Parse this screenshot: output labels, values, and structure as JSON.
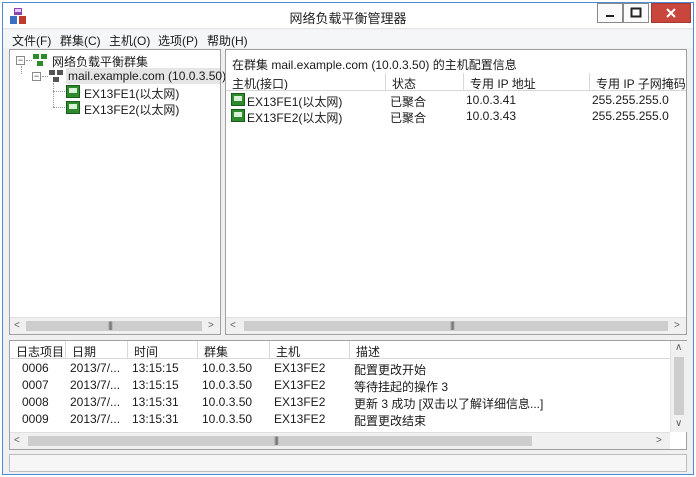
{
  "window": {
    "title": "网络负载平衡管理器"
  },
  "menu": [
    "文件(F)",
    "群集(C)",
    "主机(O)",
    "选项(P)",
    "帮助(H)"
  ],
  "tree": {
    "root": "网络负载平衡群集",
    "cluster": "mail.example.com (10.0.3.50)",
    "hosts": [
      "EX13FE1(以太网)",
      "EX13FE2(以太网)"
    ]
  },
  "host_panel": {
    "header": "在群集 mail.example.com (10.0.3.50) 的主机配置信息",
    "columns": [
      "主机(接口)",
      "状态",
      "专用 IP 地址",
      "专用 IP 子网掩码"
    ],
    "rows": [
      [
        "EX13FE1(以太网)",
        "已聚合",
        "10.0.3.41",
        "255.255.255.0"
      ],
      [
        "EX13FE2(以太网)",
        "已聚合",
        "10.0.3.43",
        "255.255.255.0"
      ]
    ]
  },
  "log": {
    "columns": [
      "日志项目",
      "日期",
      "时间",
      "群集",
      "主机",
      "描述"
    ],
    "rows": [
      [
        "0006",
        "2013/7/...",
        "13:15:15",
        "10.0.3.50",
        "EX13FE2",
        "配置更改开始"
      ],
      [
        "0007",
        "2013/7/...",
        "13:15:15",
        "10.0.3.50",
        "EX13FE2",
        "等待挂起的操作 3"
      ],
      [
        "0008",
        "2013/7/...",
        "13:15:31",
        "10.0.3.50",
        "EX13FE2",
        "更新 3 成功 [双击以了解详细信息...]"
      ],
      [
        "0009",
        "2013/7/...",
        "13:15:31",
        "10.0.3.50",
        "EX13FE2",
        "配置更改结束"
      ]
    ]
  },
  "icons": {
    "app": "nlb-manager-icon",
    "host": "host-icon",
    "cluster": "cluster-icon"
  },
  "colors": {
    "close_button": "#c9463d",
    "window_border": "#4a8ad8",
    "host_icon": "#2d8a2d"
  }
}
